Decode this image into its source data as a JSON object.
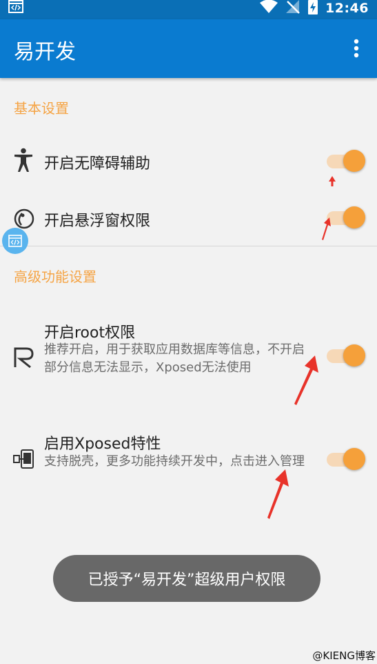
{
  "status_bar": {
    "time": "12:46"
  },
  "app_bar": {
    "title": "易开发"
  },
  "sections": {
    "basic": {
      "title": "基本设置",
      "accessibility": {
        "title": "开启无障碍辅助",
        "enabled": true
      },
      "floating_window": {
        "title": "开启悬浮窗权限",
        "enabled": true
      }
    },
    "advanced": {
      "title": "高级功能设置",
      "root": {
        "title": "开启root权限",
        "summary": "推荐开启，用于获取应用数据库等信息，不开启部分信息无法显示，Xposed无法使用",
        "enabled": true
      },
      "xposed": {
        "title": "启用Xposed特性",
        "summary": "支持脱壳，更多功能持续开发中，点击进入管理",
        "enabled": true
      }
    }
  },
  "toast": {
    "text": "已授予“易开发”超级用户权限"
  },
  "watermark": "@KIENG博客",
  "colors": {
    "app_bar": "#0a7bd0",
    "status_bar": "#0a6fb6",
    "accent": "#f5a03a",
    "annotation_arrow": "#e8332a"
  }
}
